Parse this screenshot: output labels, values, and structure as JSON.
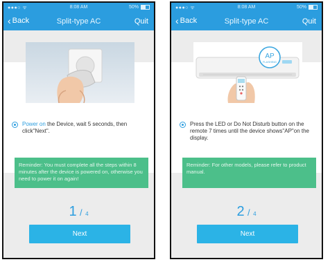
{
  "statusbar": {
    "signal": "●●●○ ",
    "time": "8:08 AM",
    "battery": "50%"
  },
  "nav": {
    "back_label": "Back",
    "title": "Split-type AC",
    "quit_label": "Quit"
  },
  "screens": [
    {
      "instruction_highlight": "Power on",
      "instruction_rest": " the Device, wait 5 seconds, then click\"Next\".",
      "reminder": "Reminder: You must complete all the steps within 8 minutes after the device is powered on, otherwise you need to power it on again!",
      "step": "1",
      "total": "4",
      "next_label": "Next"
    },
    {
      "instruction_highlight": "",
      "instruction_rest": "Press the LED or Do Not Disturb button on the remote 7 times until the device shows\"AP\"on the display.",
      "reminder": "Reminder: For other models, please refer to product manual.",
      "step": "2",
      "total": "4",
      "next_label": "Next",
      "ap_label": "AP",
      "flashing_label": "FLASHING"
    }
  ],
  "colors": {
    "primary": "#2b9ddf",
    "reminder": "#4cbf8a",
    "button": "#2bb3e6"
  }
}
